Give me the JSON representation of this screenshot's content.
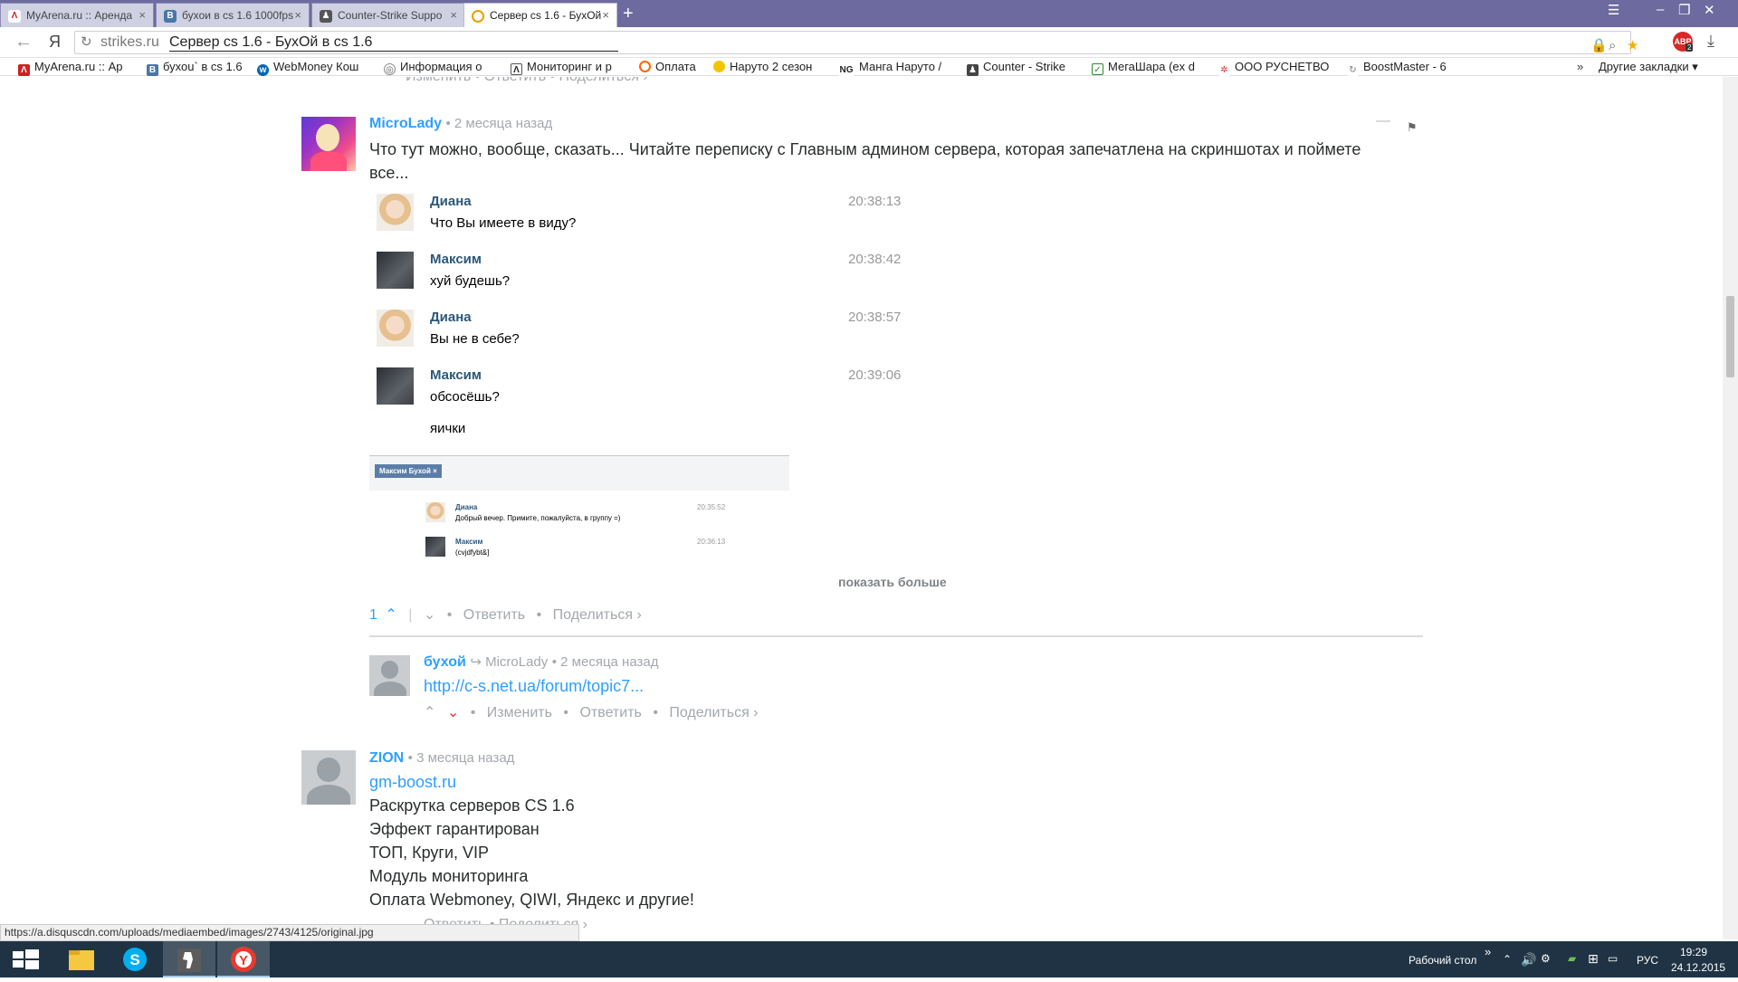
{
  "browser": {
    "tabs": [
      {
        "label": "MyArena.ru :: Аренда",
        "icon": "myarena-icon"
      },
      {
        "label": "бухoи в cs 1.6 1000fps",
        "icon": "vk-icon"
      },
      {
        "label": "Counter-Strike Suppo",
        "icon": "cs-icon"
      },
      {
        "label": "Сервер cs 1.6 - БухОй",
        "icon": "disqus-icon"
      }
    ],
    "address": {
      "domain": "strikes.ru",
      "title": "Сервер cs 1.6 - БухОй в cs 1.6",
      "yandex_glyph": "Я"
    },
    "bookmarks": [
      "MyArena.ru :: Ар",
      "бухоu` в cs 1.6",
      "WebMoney Кош",
      "Информация о",
      "Мониторинг и р",
      "Оплата",
      "Наруто 2 сезон",
      "Манга Наруто /",
      "Counter - Strike",
      "МегаШара (ex d",
      "ООО РУСНЕТВО",
      "BoostMaster - 6"
    ],
    "other_bookmarks": "Другие закладки",
    "abp_badge": "2"
  },
  "comment1": {
    "author": "MicroLady",
    "time": "2 месяца назад",
    "text_line1": "Что тут можно, вообще, сказать... Читайте переписку с Главным админом сервера, которая запечатлена на скриншотах и поймете",
    "text_line2": "все...",
    "chat": [
      {
        "name": "Диана",
        "text": "Что Вы имеете в виду?",
        "time": "20:38:13"
      },
      {
        "name": "Максим",
        "text": "хуй будешь?",
        "time": "20:38:42"
      },
      {
        "name": "Диана",
        "text": "Вы не в себе?",
        "time": "20:38:57"
      },
      {
        "name": "Максим",
        "text": "обсосёшь?",
        "time": "20:39:06"
      }
    ],
    "chat_extra": "яички",
    "shot2": {
      "tag": "Максим Бухой",
      "msgs": [
        {
          "name": "Диана",
          "text": "Добрый вечер. Примите, пожалуйста, в группу =)",
          "time": "20:35:52"
        },
        {
          "name": "Максим",
          "text": "(cvjdfybt&]",
          "time": "20:36:13"
        }
      ]
    },
    "show_more": "показать больше",
    "votes": "1",
    "reply": "Ответить",
    "share": "Поделиться ›"
  },
  "reply1": {
    "author": "бухой",
    "reply_to": "MicroLady",
    "time": "2 месяца назад",
    "link": "http://c-s.net.ua/forum/topic7...",
    "edit": "Изменить",
    "reply": "Ответить",
    "share": "Поделиться ›"
  },
  "comment2": {
    "author": "ZION",
    "time": "3 месяца назад",
    "link": "gm-boost.ru",
    "lines": [
      "Раскрутка серверов CS 1.6",
      "Эффект гарантирован",
      "ТОП, Круги, VIP",
      "Модуль мониторинга",
      "Оплата Webmoney, QIWI, Яндекс и другие!"
    ],
    "partial_actions": "Ответить • Поделиться ›"
  },
  "top_partial": "Изменить • Ответить • Поделиться ›",
  "status_url": "https://a.disquscdn.com/uploads/mediaembed/images/2743/4125/original.jpg",
  "taskbar": {
    "desktop_label": "Рабочий стол",
    "lang": "РУС",
    "time": "19:29",
    "date": "24.12.2015"
  }
}
